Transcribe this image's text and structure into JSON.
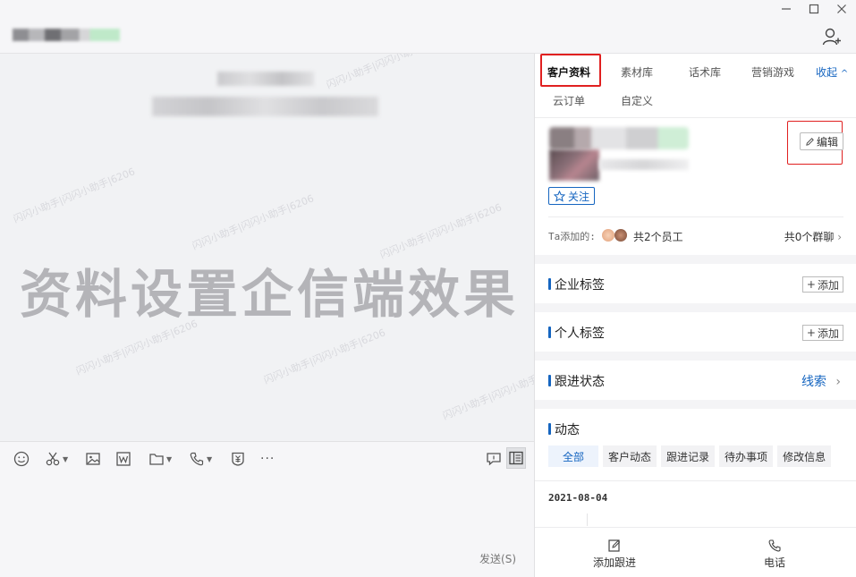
{
  "window": {
    "controls": {
      "minimize_icon": "minimize-icon",
      "maximize_icon": "maximize-icon",
      "close_icon": "close-icon"
    },
    "add_contact_icon": "add-contact-icon"
  },
  "chat": {
    "overlay_title": "资料设置企信端效果",
    "watermark_text": "闪闪小助手|闪闪小助手|6206"
  },
  "toolbar": {
    "tools": [
      "emoji-icon",
      "scissors-icon",
      "image-icon",
      "word-icon",
      "folder-icon",
      "phone-icon",
      "red-packet-icon",
      "more-icon"
    ],
    "more_label": "···",
    "send_label": "发送(S)"
  },
  "panel": {
    "tabs_row1": [
      "客户资料",
      "素材库",
      "话术库",
      "营销游戏"
    ],
    "collapse_label": "收起",
    "tabs_row2": [
      "云订单",
      "自定义"
    ],
    "profile": {
      "follow_label": "关注",
      "edit_label": "编辑",
      "added_by_label": "Ta添加的:",
      "staff_count_label": "共2个员工",
      "group_count_label": "共0个群聊"
    },
    "sections": {
      "company_tags": "企业标签",
      "personal_tags": "个人标签",
      "add_label": "添加",
      "follow_status": "跟进状态",
      "follow_status_value": "线索",
      "activity": "动态"
    },
    "activity_filters": [
      "全部",
      "客户动态",
      "跟进记录",
      "待办事项",
      "修改信息"
    ],
    "activity_date": "2021-08-04",
    "bottom_actions": {
      "add_follow_label": "添加跟进",
      "phone_label": "电话"
    }
  },
  "colors": {
    "accent": "#1565c0",
    "highlight_box": "#e02020",
    "chat_bg": "#f1f2f4"
  }
}
